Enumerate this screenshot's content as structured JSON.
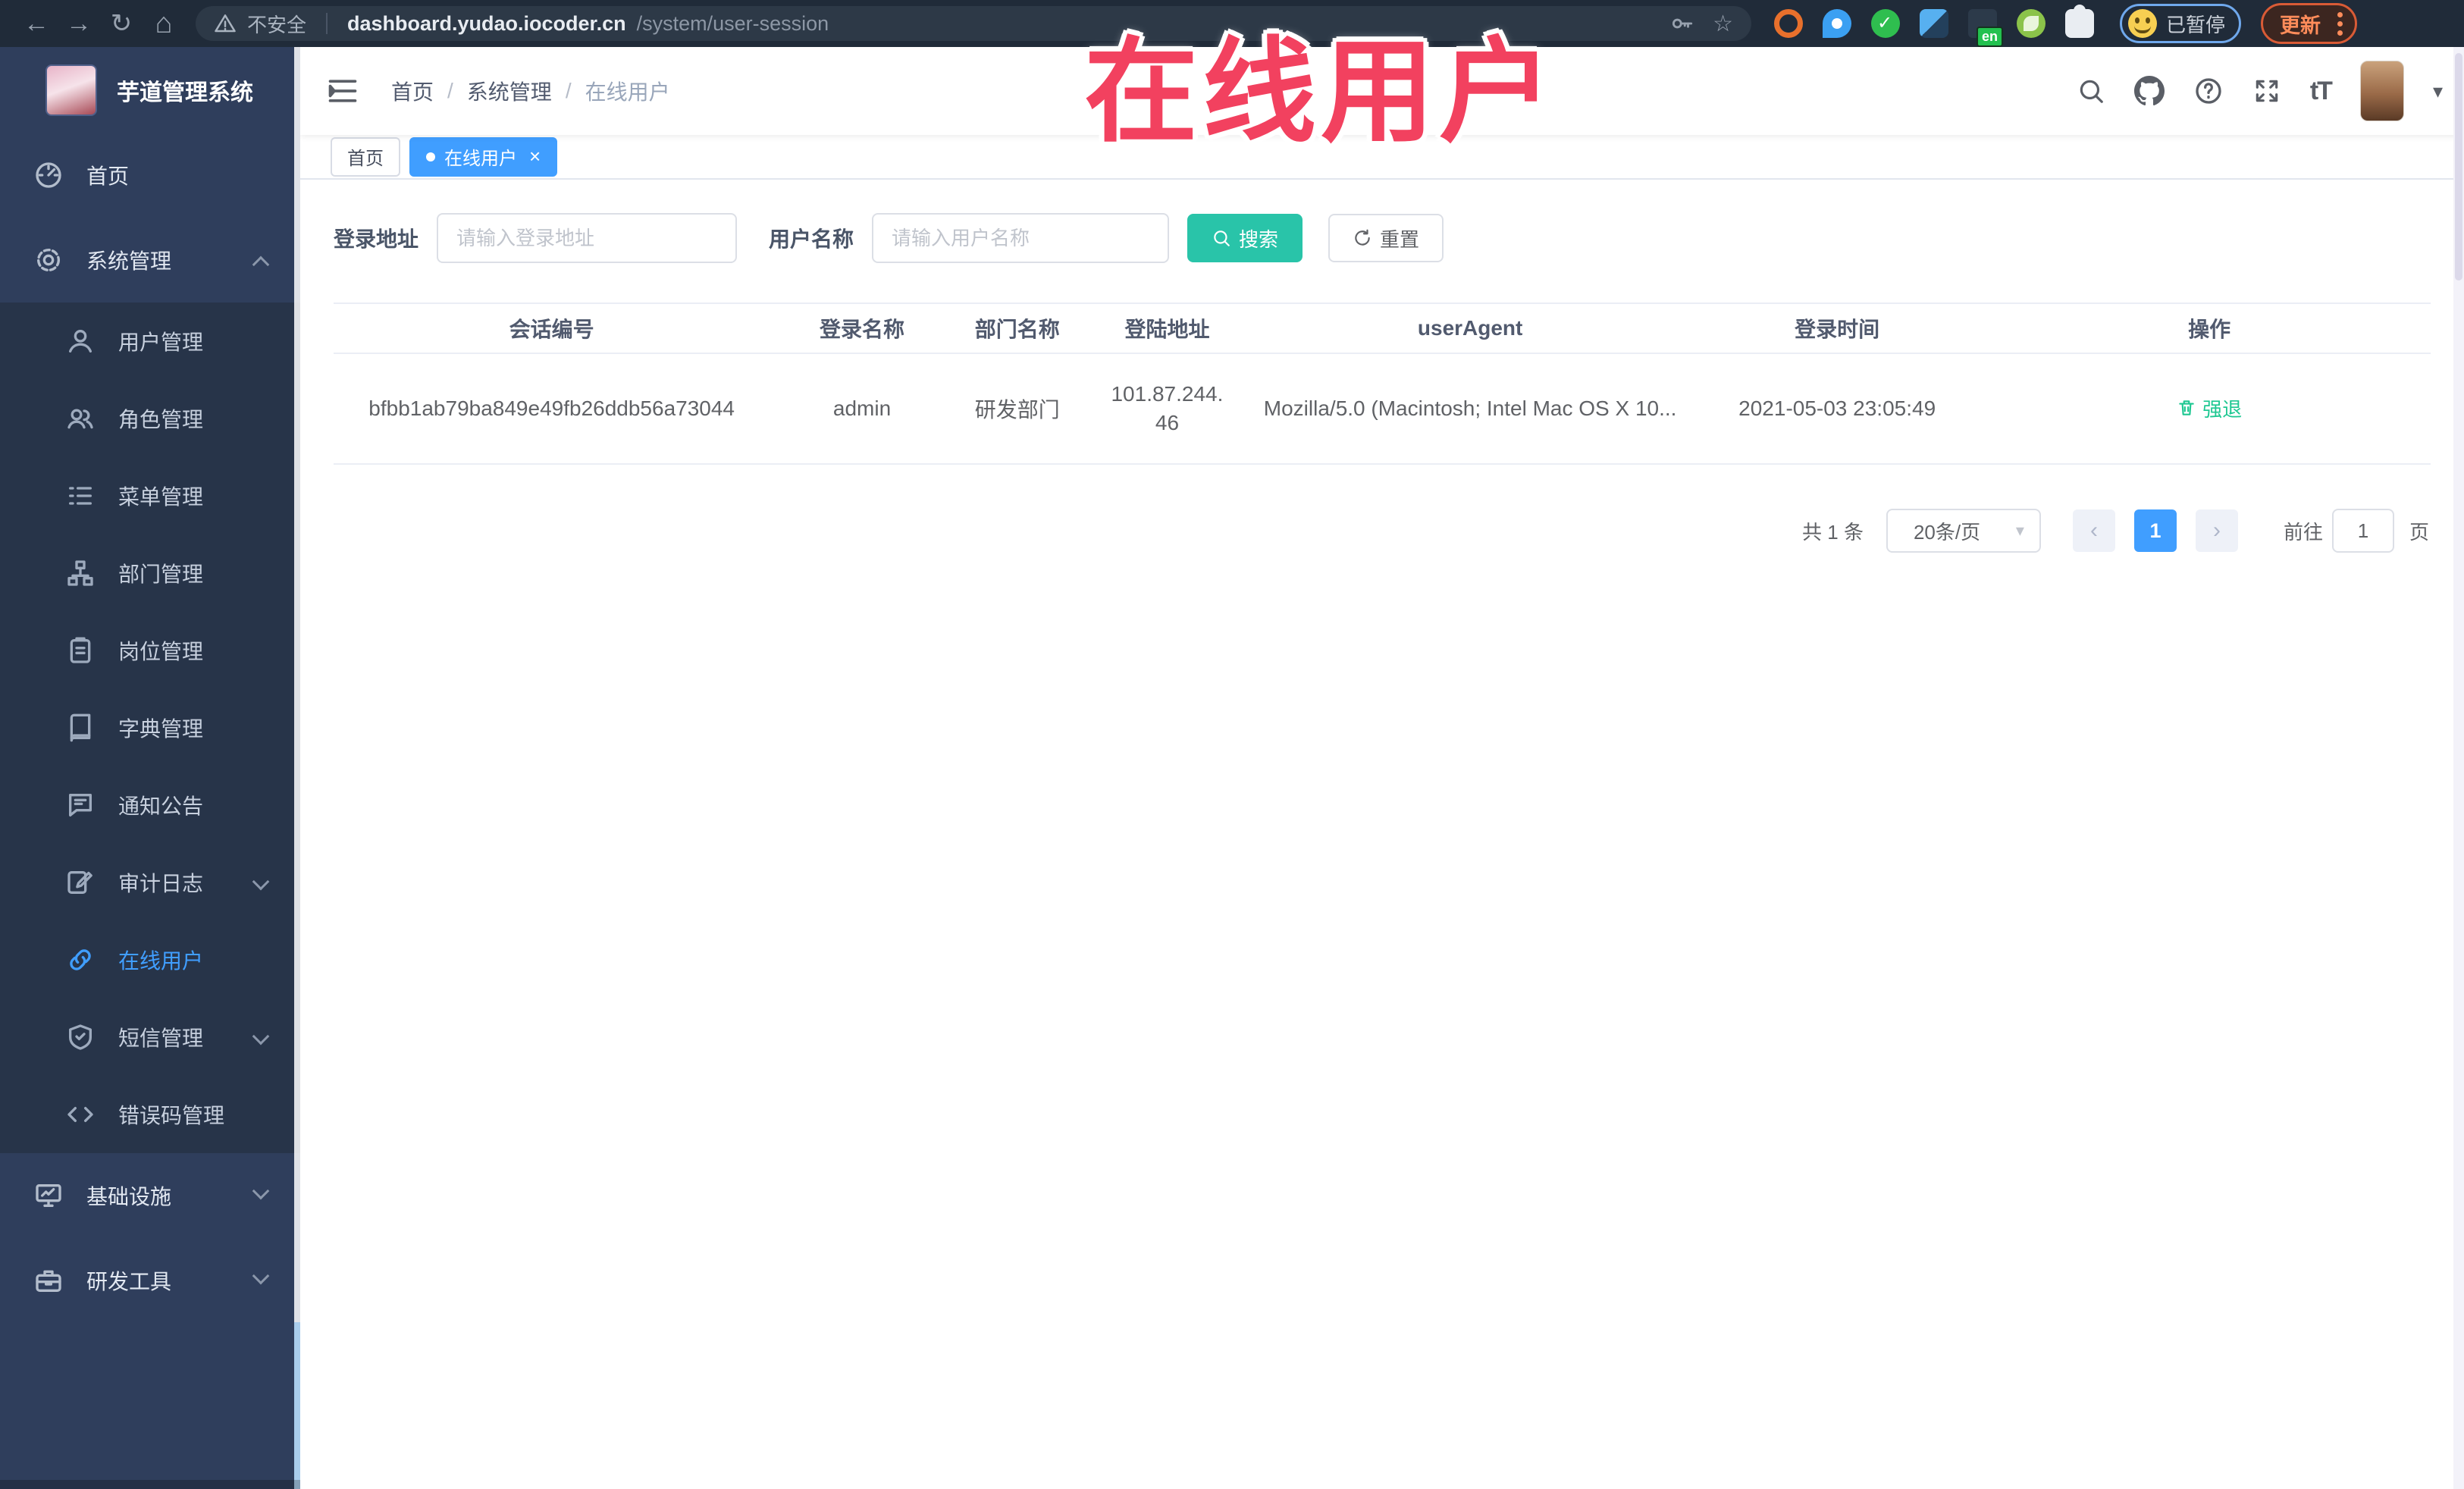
{
  "browser": {
    "security_warning": "不安全",
    "url_host": "dashboard.yudao.iocoder.cn",
    "url_path": "/system/user-session",
    "extension_badge": "en",
    "paused_badge": "已暂停",
    "update_label": "更新",
    "icons": [
      "back-icon",
      "forward-icon",
      "reload-icon",
      "home-icon",
      "warning-icon",
      "key-icon",
      "star-icon",
      "kebab-menu-icon"
    ]
  },
  "overlay": {
    "title": "在线用户"
  },
  "sidebar": {
    "app_title": "芋道管理系统",
    "items": [
      {
        "label": "首页",
        "icon": "dashboard-icon"
      },
      {
        "label": "系统管理",
        "icon": "gear-icon",
        "expanded": true
      }
    ],
    "submenu": [
      {
        "label": "用户管理",
        "icon": "user-icon"
      },
      {
        "label": "角色管理",
        "icon": "users-icon"
      },
      {
        "label": "菜单管理",
        "icon": "menu-list-icon"
      },
      {
        "label": "部门管理",
        "icon": "org-tree-icon"
      },
      {
        "label": "岗位管理",
        "icon": "badge-icon"
      },
      {
        "label": "字典管理",
        "icon": "book-icon"
      },
      {
        "label": "通知公告",
        "icon": "chat-bubble-icon"
      },
      {
        "label": "审计日志",
        "icon": "log-icon",
        "collapsible": true
      },
      {
        "label": "在线用户",
        "icon": "link-icon",
        "active": true
      },
      {
        "label": "短信管理",
        "icon": "shield-check-icon",
        "collapsible": true
      },
      {
        "label": "错误码管理",
        "icon": "code-icon"
      }
    ],
    "bottom_items": [
      {
        "label": "基础设施",
        "icon": "monitor-icon",
        "collapsible": true
      },
      {
        "label": "研发工具",
        "icon": "toolbox-icon",
        "collapsible": true
      }
    ]
  },
  "header": {
    "breadcrumb": [
      "首页",
      "系统管理",
      "在线用户"
    ],
    "breadcrumb_separator": "/",
    "font_size_icon_text": "tT",
    "icons": [
      "search-icon",
      "github-icon",
      "help-icon",
      "fullscreen-icon",
      "font-size-icon",
      "avatar",
      "caret-down-icon"
    ]
  },
  "tags": [
    {
      "label": "首页",
      "active": false
    },
    {
      "label": "在线用户",
      "active": true,
      "close": "×"
    }
  ],
  "filters": {
    "address_label": "登录地址",
    "address_placeholder": "请输入登录地址",
    "username_label": "用户名称",
    "username_placeholder": "请输入用户名称",
    "search_label": "搜索",
    "reset_label": "重置"
  },
  "table": {
    "columns": [
      "会话编号",
      "登录名称",
      "部门名称",
      "登陆地址",
      "userAgent",
      "登录时间",
      "操作"
    ],
    "rows": [
      {
        "session_id": "bfbb1ab79ba849e49fb26ddb56a73044",
        "username": "admin",
        "dept": "研发部门",
        "ip": "101.87.244.46",
        "user_agent": "Mozilla/5.0 (Macintosh; Intel Mac OS X 10...",
        "login_time": "2021-05-03 23:05:49",
        "action": "强退"
      }
    ]
  },
  "pagination": {
    "total": "共 1 条",
    "page_size": "20条/页",
    "prev": "‹",
    "current": "1",
    "next": "›",
    "goto": "前往",
    "goto_value": "1",
    "unit": "页"
  },
  "colors": {
    "accent": "#409eff",
    "search_button": "#29c4a9",
    "action_green": "#1dc791",
    "overlay_red": "#f2415f",
    "sidebar_bg": "#2f3e5c",
    "submenu_bg": "#273449"
  }
}
